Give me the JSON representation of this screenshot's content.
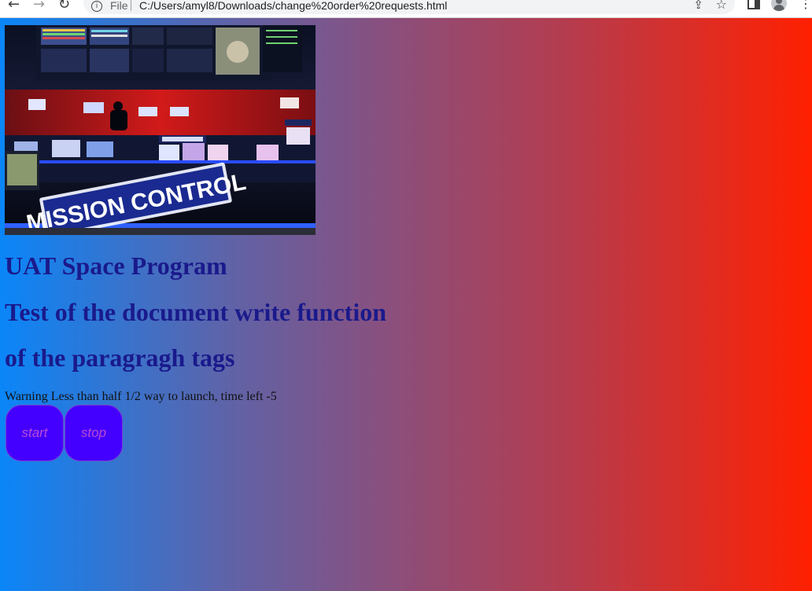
{
  "browser": {
    "scheme_label": "File",
    "url": "C:/Users/amyl8/Downloads/change%20order%20requests.html"
  },
  "page": {
    "hero_image_alt": "MISSION CONTROL",
    "heading_1": "UAT Space Program",
    "heading_2": "Test of the document write function",
    "heading_3": "of the paragragh tags",
    "warning_text": "Warning Less than half 1/2 way to launch, time left -5",
    "start_label": "start",
    "stop_label": "stop"
  },
  "colors": {
    "gradient_left": "#0a86f8",
    "gradient_right": "#ff2000",
    "heading": "#1a1a8c",
    "button_fill": "#4400ff",
    "button_text": "#b84ad6"
  }
}
